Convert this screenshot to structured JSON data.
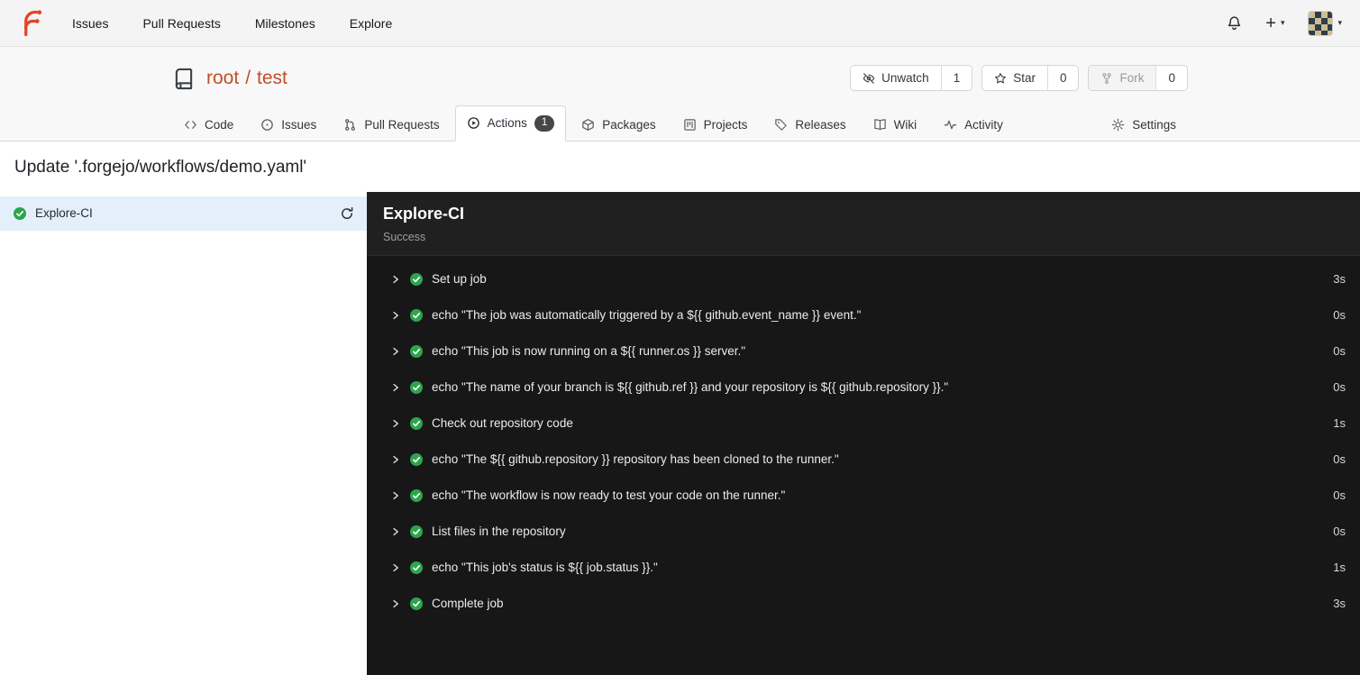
{
  "navbar": {
    "items": [
      {
        "label": "Issues"
      },
      {
        "label": "Pull Requests"
      },
      {
        "label": "Milestones"
      },
      {
        "label": "Explore"
      }
    ]
  },
  "repo": {
    "owner": "root",
    "separator": "/",
    "name": "test",
    "actions": {
      "unwatch": {
        "label": "Unwatch",
        "count": "1"
      },
      "star": {
        "label": "Star",
        "count": "0"
      },
      "fork": {
        "label": "Fork",
        "count": "0"
      }
    },
    "tabs": [
      {
        "label": "Code"
      },
      {
        "label": "Issues"
      },
      {
        "label": "Pull Requests"
      },
      {
        "label": "Actions",
        "badge": "1"
      },
      {
        "label": "Packages"
      },
      {
        "label": "Projects"
      },
      {
        "label": "Releases"
      },
      {
        "label": "Wiki"
      },
      {
        "label": "Activity"
      },
      {
        "label": "Settings"
      }
    ]
  },
  "page": {
    "title": "Update '.forgejo/workflows/demo.yaml'"
  },
  "sidebar": {
    "job": {
      "name": "Explore-CI"
    }
  },
  "run": {
    "title": "Explore-CI",
    "status": "Success",
    "steps": [
      {
        "label": "Set up job",
        "duration": "3s"
      },
      {
        "label": "echo \"The job was automatically triggered by a ${{ github.event_name }} event.\"",
        "duration": "0s"
      },
      {
        "label": "echo \"This job is now running on a ${{ runner.os }} server.\"",
        "duration": "0s"
      },
      {
        "label": "echo \"The name of your branch is ${{ github.ref }} and your repository is ${{ github.repository }}.\"",
        "duration": "0s"
      },
      {
        "label": "Check out repository code",
        "duration": "1s"
      },
      {
        "label": "echo \"The ${{ github.repository }} repository has been cloned to the runner.\"",
        "duration": "0s"
      },
      {
        "label": "echo \"The workflow is now ready to test your code on the runner.\"",
        "duration": "0s"
      },
      {
        "label": "List files in the repository",
        "duration": "0s"
      },
      {
        "label": "echo \"This job's status is ${{ job.status }}.\"",
        "duration": "1s"
      },
      {
        "label": "Complete job",
        "duration": "3s"
      }
    ]
  },
  "colors": {
    "accent": "#c24e27",
    "success_green": "#2da44e",
    "panel_dark": "#171717",
    "selected_job_bg": "#e3f0fb"
  }
}
